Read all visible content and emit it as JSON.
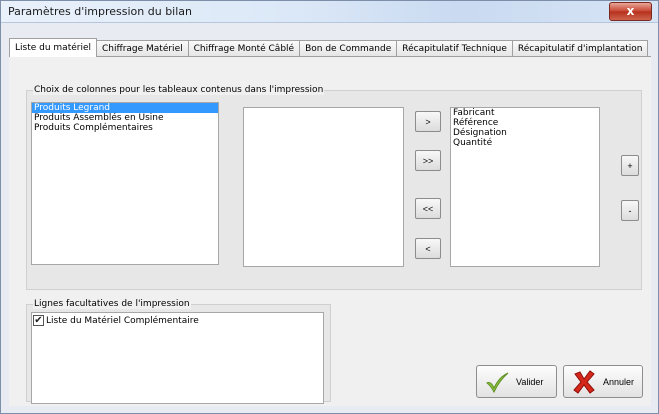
{
  "window": {
    "title": "Paramètres d'impression du bilan",
    "close_label": "x"
  },
  "tabs": [
    {
      "label": "Liste du matériel",
      "active": true
    },
    {
      "label": "Chiffrage Matériel",
      "active": false
    },
    {
      "label": "Chiffrage Monté Câblé",
      "active": false
    },
    {
      "label": "Bon de Commande",
      "active": false
    },
    {
      "label": "Récapitulatif Technique",
      "active": false
    },
    {
      "label": "Récapitulatif d'implantation",
      "active": false
    }
  ],
  "columns_group": {
    "label": "Choix de colonnes pour les tableaux contenus dans l'impression",
    "source_list": [
      {
        "label": "Produits Legrand",
        "selected": true
      },
      {
        "label": "Produits Assemblés en Usine",
        "selected": false
      },
      {
        "label": "Produits Complémentaires",
        "selected": false
      }
    ],
    "available_list": [],
    "chosen_list": [
      "Fabricant",
      "Référence",
      "Désignation",
      "Quantité"
    ],
    "buttons": {
      "add": ">",
      "add_all": ">>",
      "remove_all": "<<",
      "remove": "<",
      "move_up": "+",
      "move_down": "-"
    }
  },
  "optional_lines_group": {
    "label": "Lignes facultatives de l'impression",
    "items": [
      {
        "label": "Liste du Matériel Complémentaire",
        "checked": true
      }
    ]
  },
  "actions": {
    "validate_label": "Valider",
    "cancel_label": "Annuler",
    "validate_icon": "green-check-icon",
    "cancel_icon": "red-x-icon"
  }
}
